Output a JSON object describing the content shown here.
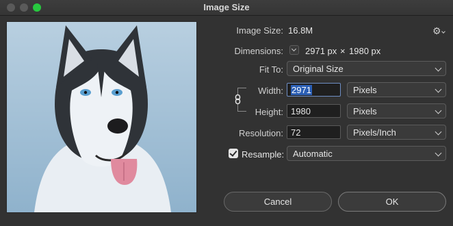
{
  "window": {
    "title": "Image Size"
  },
  "image_size": {
    "label": "Image Size:",
    "value": "16.8M"
  },
  "dimensions": {
    "label": "Dimensions:",
    "width": "2971 px",
    "times": "×",
    "height": "1980 px"
  },
  "fit_to": {
    "label": "Fit To:",
    "value": "Original Size"
  },
  "width": {
    "label": "Width:",
    "value": "2971",
    "unit": "Pixels"
  },
  "height": {
    "label": "Height:",
    "value": "1980",
    "unit": "Pixels"
  },
  "resolution": {
    "label": "Resolution:",
    "value": "72",
    "unit": "Pixels/Inch"
  },
  "resample": {
    "label": "Resample:",
    "checked": true,
    "value": "Automatic"
  },
  "buttons": {
    "cancel": "Cancel",
    "ok": "OK"
  },
  "icons": {
    "gear": "gear-icon",
    "link": "link-icon",
    "check": "check-icon"
  },
  "colors": {
    "accent": "#2b5fb5",
    "zoom_light": "#27c93f"
  }
}
